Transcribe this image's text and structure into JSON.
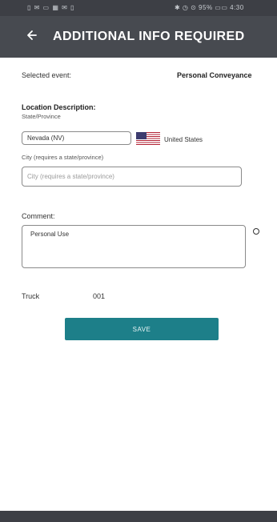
{
  "status_bar": {
    "left_text": "▯ ✉ ▭ ▦ ✉ ▯",
    "right_text": "✱ ◷ ⊙ 95% ▭▭ 4:30"
  },
  "header": {
    "back_icon": "back-arrow-icon",
    "title": "ADDITIONAL INFO REQUIRED"
  },
  "selected_event": {
    "label": "Selected event:",
    "value": "Personal Conveyance"
  },
  "location": {
    "title": "Location Description:",
    "state_label": "State/Province",
    "state_value": "Nevada (NV)",
    "country": "United States",
    "flag_icon": "us-flag-icon",
    "city_label": "City (requires a state/province)",
    "city_placeholder": "City (requires a state/province)"
  },
  "comment": {
    "label": "Comment:",
    "value": "Personal Use",
    "info_icon": "circle-icon"
  },
  "truck": {
    "label": "Truck",
    "value": "001"
  },
  "save_button": {
    "label": "SAVE"
  },
  "colors": {
    "header": "#474a50",
    "status_bar": "#3d3f45",
    "button": "#1d7f89"
  }
}
